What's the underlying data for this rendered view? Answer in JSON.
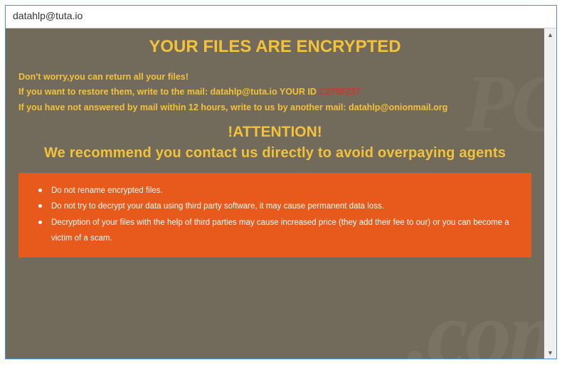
{
  "titlebar": {
    "title": "datahlp@tuta.io"
  },
  "heading": "YOUR FILES ARE ENCRYPTED",
  "intro": {
    "line1": "Don't worry,you can return all your files!",
    "line2_prefix": "If you want to restore them, write to the mail:  ",
    "email1": "datahlp@tuta.io",
    "your_id_label": "  YOUR ID ",
    "your_id": "C279F237",
    "line3_prefix": "If you have not answered by mail within 12 hours, write to us by another mail: ",
    "email2": "datahlp@onionmail.org"
  },
  "attention": "!ATTENTION!",
  "recommend": "We recommend you contact us directly to avoid overpaying agents",
  "warnings": [
    "Do not rename encrypted files.",
    "Do not try to decrypt your data using third party software, it may cause permanent data loss.",
    "Decryption of your files with the help of third parties may cause increased price (they add their fee to our) or you can become a victim of a scam."
  ],
  "watermark": ".com",
  "watermark2": "PC"
}
